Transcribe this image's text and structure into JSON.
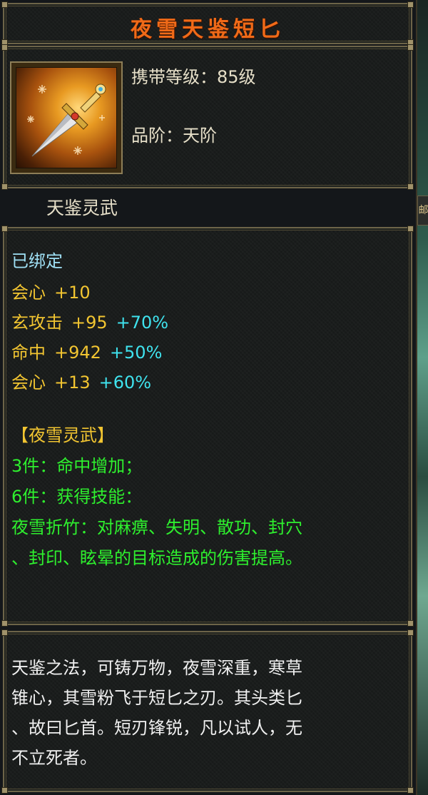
{
  "item": {
    "name": "夜雪天鉴短匕",
    "level_label": "携带等级：",
    "level_value": "85级",
    "grade_label": "品阶：",
    "grade_value": "天阶",
    "icon": "dagger-icon"
  },
  "spirit_weapon": "天鉴灵武",
  "attributes": {
    "bound": "已绑定",
    "base": [
      {
        "name": "会心",
        "value": "+10"
      }
    ],
    "refined": [
      {
        "name": "玄攻击",
        "value": "+95",
        "bonus": "+70%"
      },
      {
        "name": "命中",
        "value": "+942",
        "bonus": "+50%"
      },
      {
        "name": "会心",
        "value": "+13",
        "bonus": "+60%"
      }
    ]
  },
  "set": {
    "title": "【夜雪灵武】",
    "effects": [
      "3件：命中增加；",
      "6件：获得技能：",
      "夜雪折竹：对麻痹、失明、散功、封穴",
      "、封印、眩晕的目标造成的伤害提高。"
    ]
  },
  "description": [
    "天鉴之法，可铸万物，夜雪深重，寒草",
    "锥心，其雪粉飞于短匕之刃。其头类匕",
    "、故曰匕首。短刃锋锐，凡以试人，无",
    "不立死者。"
  ],
  "side_tab": "邮",
  "colors": {
    "title": "#f06a18",
    "gold": "#f2c531",
    "cyan": "#3fe3ee",
    "green": "#2ef02e",
    "border": "#6d6448"
  }
}
